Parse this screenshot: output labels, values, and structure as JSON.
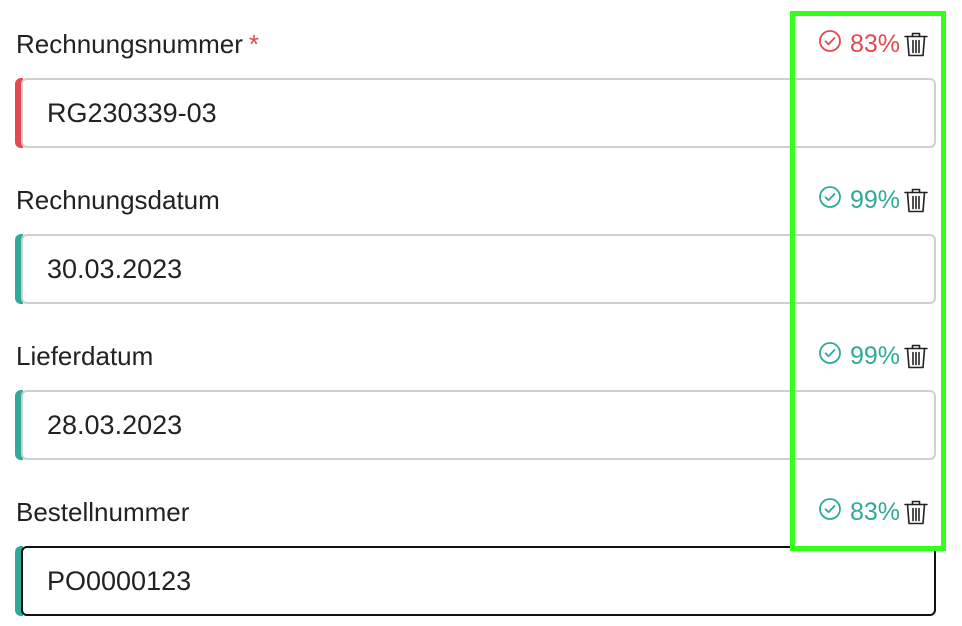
{
  "colors": {
    "error": "#e5484d",
    "ok": "#2ea99a",
    "highlight": "#33ff1a",
    "border": "#cfcfcf",
    "focus_border": "#111111"
  },
  "fields": [
    {
      "label": "Rechnungsnummer",
      "required_mark": "*",
      "value": "RG230339-03",
      "confidence": "83%",
      "status": "error",
      "status_icon": "check-circle-icon",
      "delete_icon": "trash-icon"
    },
    {
      "label": "Rechnungsdatum",
      "value": "30.03.2023",
      "confidence": "99%",
      "status": "ok",
      "status_icon": "check-circle-icon",
      "delete_icon": "trash-icon"
    },
    {
      "label": "Lieferdatum",
      "value": "28.03.2023",
      "confidence": "99%",
      "status": "ok",
      "status_icon": "check-circle-icon",
      "delete_icon": "trash-icon"
    },
    {
      "label": "Bestellnummer",
      "value": "PO0000123",
      "confidence": "83%",
      "status": "ok",
      "focused": true,
      "status_icon": "check-circle-icon",
      "delete_icon": "trash-icon"
    }
  ]
}
